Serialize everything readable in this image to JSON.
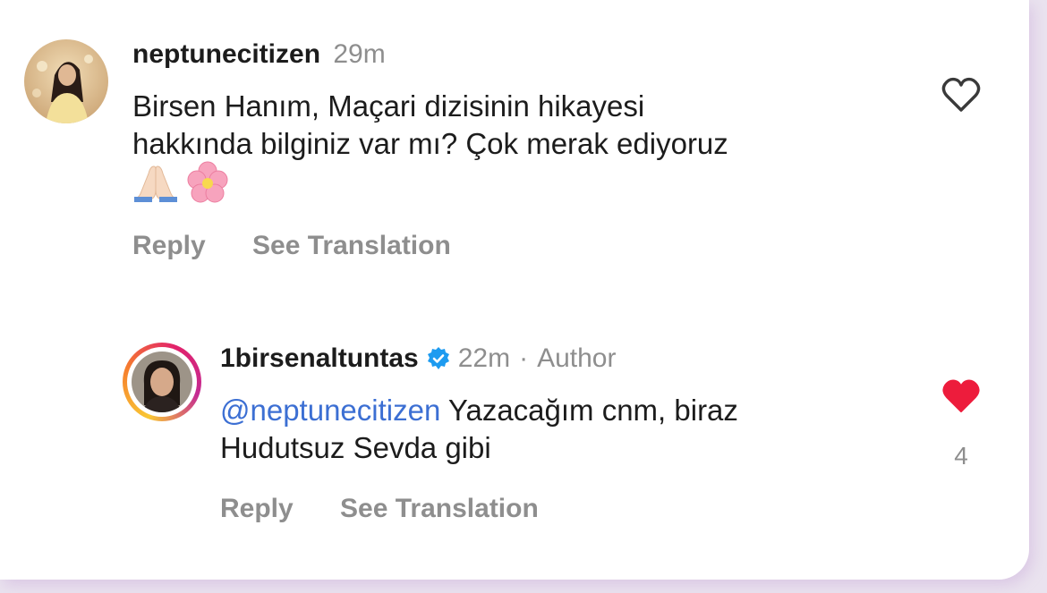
{
  "comment": {
    "username": "neptunecitizen",
    "time": "29m",
    "text_line1": "Birsen Hanım, Maçari dizisinin hikayesi",
    "text_line2": "hakkında bilginiz var mı? Çok merak ediyoruz",
    "emojis": "🙏🏻🌸",
    "reply_label": "Reply",
    "translate_label": "See Translation",
    "like_icon": "heart-outline-icon",
    "liked": false
  },
  "reply": {
    "username": "1birsenaltuntas",
    "verified_icon": "verified-badge-icon",
    "time": "22m",
    "separator": "·",
    "author_label": "Author",
    "mention": "@neptunecitizen",
    "text_rest_line1": "Yazacağım cnm, biraz",
    "text_line2": "Hudutsuz Sevda gibi",
    "reply_label": "Reply",
    "translate_label": "See Translation",
    "like_icon": "heart-filled-icon",
    "liked": true,
    "like_count": "4"
  },
  "colors": {
    "accent_blue": "#3c6fd3",
    "like_red": "#ed1c3c",
    "muted": "#8e8e8e",
    "verified_blue": "#1d9bf0"
  }
}
